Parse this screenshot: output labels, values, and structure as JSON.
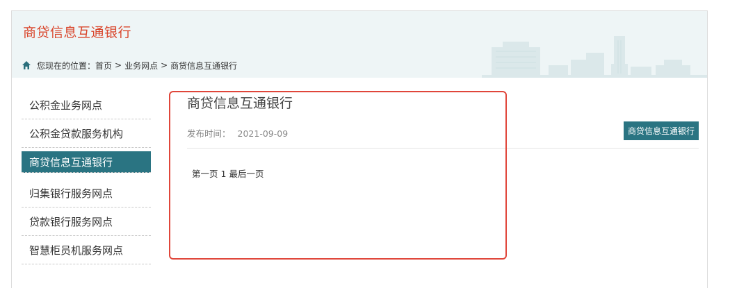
{
  "header": {
    "title": "商贷信息互通银行"
  },
  "breadcrumb": {
    "prefix": "您现在的位置：",
    "items": [
      "首页",
      "业务网点",
      "商贷信息互通银行"
    ],
    "separator": ">"
  },
  "sidebar": {
    "items": [
      {
        "label": "公积金业务网点"
      },
      {
        "label": "公积金贷款服务机构"
      },
      {
        "label": "商贷信息互通银行"
      },
      {
        "label": "归集银行服务网点"
      },
      {
        "label": "贷款银行服务网点"
      },
      {
        "label": "智慧柜员机服务网点"
      }
    ],
    "active_index": 2
  },
  "article": {
    "title": "商贷信息互通银行",
    "publish_label": "发布时间：",
    "publish_date": "2021-09-09",
    "category_button": "商贷信息互通银行"
  },
  "pager": {
    "first": "第一页",
    "current": "1",
    "last": "最后一页"
  },
  "colors": {
    "brand_red": "#d9452b",
    "teal": "#2a7482",
    "highlight_red": "#e0463a",
    "header_bg": "#eef5f6"
  }
}
